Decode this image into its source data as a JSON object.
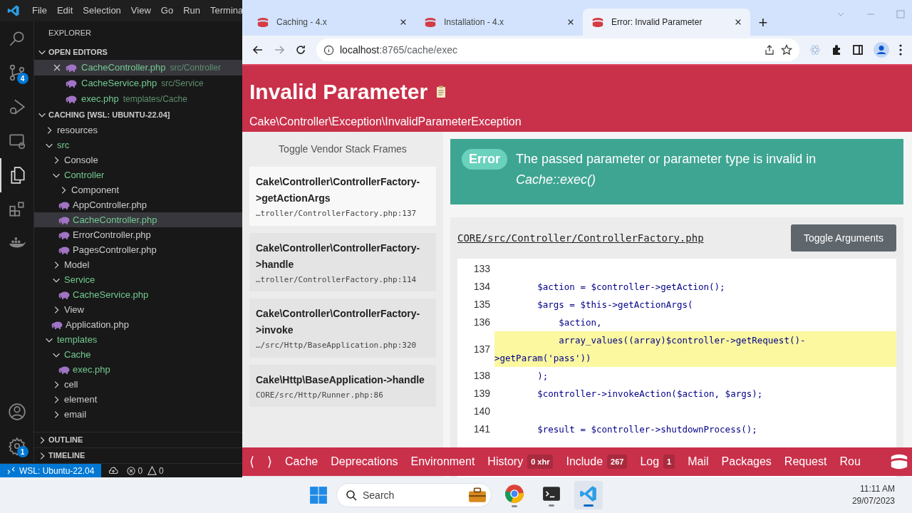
{
  "vscode": {
    "menu": [
      "File",
      "Edit",
      "Selection",
      "View",
      "Go",
      "Run",
      "Termina"
    ],
    "activity": [
      {
        "kind": "search",
        "selected": false
      },
      {
        "kind": "source-control",
        "selected": false,
        "badge": "4"
      },
      {
        "kind": "run-debug",
        "selected": false
      },
      {
        "kind": "remote",
        "selected": false
      },
      {
        "kind": "explorer",
        "selected": true
      },
      {
        "kind": "extensions",
        "selected": false
      },
      {
        "kind": "docker",
        "selected": false
      }
    ],
    "activity_bottom": [
      {
        "kind": "account"
      },
      {
        "kind": "settings",
        "badge": "1"
      }
    ],
    "explorer_title": "EXPLORER",
    "open_editors": {
      "title": "OPEN EDITORS",
      "expanded": true,
      "items": [
        {
          "name": "CacheController.php",
          "path": "src/Controller",
          "selected": true
        },
        {
          "name": "CacheService.php",
          "path": "src/Service",
          "selected": false
        },
        {
          "name": "exec.php",
          "path": "templates/Cache",
          "selected": false
        }
      ]
    },
    "workspace": {
      "title": "CACHING [WSL: UBUNTU-22.04]",
      "expanded": true,
      "tree": [
        {
          "label": "resources",
          "kind": "folder",
          "expanded": false,
          "added": false,
          "selected": false
        },
        {
          "label": "src",
          "kind": "folder",
          "expanded": true,
          "added": true,
          "selected": false,
          "children": [
            {
              "label": "Console",
              "kind": "folder",
              "expanded": false,
              "added": false,
              "selected": false
            },
            {
              "label": "Controller",
              "kind": "folder",
              "expanded": true,
              "added": true,
              "selected": false,
              "children": [
                {
                  "label": "Component",
                  "kind": "folder",
                  "expanded": false,
                  "added": false,
                  "selected": false
                },
                {
                  "label": "AppController.php",
                  "kind": "file",
                  "added": false,
                  "selected": false
                },
                {
                  "label": "CacheController.php",
                  "kind": "file",
                  "added": true,
                  "selected": true
                },
                {
                  "label": "ErrorController.php",
                  "kind": "file",
                  "added": false,
                  "selected": false
                },
                {
                  "label": "PagesController.php",
                  "kind": "file",
                  "added": false,
                  "selected": false
                }
              ]
            },
            {
              "label": "Model",
              "kind": "folder",
              "expanded": false,
              "added": false,
              "selected": false
            },
            {
              "label": "Service",
              "kind": "folder",
              "expanded": true,
              "added": true,
              "selected": false,
              "children": [
                {
                  "label": "CacheService.php",
                  "kind": "file",
                  "added": true,
                  "selected": false
                }
              ]
            },
            {
              "label": "View",
              "kind": "folder",
              "expanded": false,
              "added": false,
              "selected": false
            },
            {
              "label": "Application.php",
              "kind": "file",
              "added": false,
              "selected": false
            }
          ]
        },
        {
          "label": "templates",
          "kind": "folder",
          "expanded": true,
          "added": true,
          "selected": false,
          "children": [
            {
              "label": "Cache",
              "kind": "folder",
              "expanded": true,
              "added": true,
              "selected": false,
              "children": [
                {
                  "label": "exec.php",
                  "kind": "file",
                  "added": true,
                  "selected": false
                }
              ]
            },
            {
              "label": "cell",
              "kind": "folder",
              "expanded": false,
              "added": false,
              "selected": false
            },
            {
              "label": "element",
              "kind": "folder",
              "expanded": false,
              "added": false,
              "selected": false
            },
            {
              "label": "email",
              "kind": "folder",
              "expanded": false,
              "added": false,
              "selected": false
            }
          ]
        }
      ]
    },
    "collapsed_sections": [
      "OUTLINE",
      "TIMELINE"
    ],
    "status_bar": {
      "remote": "WSL: Ubuntu-22.04",
      "errors": "0",
      "warnings": "0"
    }
  },
  "browser": {
    "tabs": [
      {
        "title": "Caching - 4.x",
        "selected": false
      },
      {
        "title": "Installation - 4.x",
        "selected": false
      },
      {
        "title": "Error: Invalid Parameter",
        "selected": true
      }
    ],
    "new_tab": "+",
    "address": {
      "host": "localhost",
      "rest": ":8765/cache/exec"
    },
    "page": {
      "title": "Invalid Parameter",
      "exception": "Cake\\Controller\\Exception\\InvalidParameterException",
      "stack_toggle": "Toggle Vendor Stack Frames",
      "frames": [
        {
          "call": "Cake\\Controller\\ControllerFactory->getActionArgs",
          "file": "…troller/ControllerFactory.php:137",
          "selected": true
        },
        {
          "call": "Cake\\Controller\\ControllerFactory->handle",
          "file": "…troller/ControllerFactory.php:114",
          "selected": false
        },
        {
          "call": "Cake\\Controller\\ControllerFactory->invoke",
          "file": "…/src/Http/BaseApplication.php:320",
          "selected": false
        },
        {
          "call": "Cake\\Http\\BaseApplication->handle",
          "file": "CORE/src/Http/Runner.php:86",
          "selected": false
        }
      ],
      "error": {
        "badge": "Error",
        "message": "The passed parameter or parameter type is invalid in *Cache::exec()*"
      },
      "file_path": "CORE/src/Controller/ControllerFactory.php",
      "toggle_arguments": "Toggle Arguments",
      "code": [
        {
          "number": "133",
          "highlighted": false
        },
        {
          "number": "134",
          "code": "        $action = $controller->getAction();",
          "highlighted": false
        },
        {
          "number": "135",
          "code": "        $args = $this->getActionArgs(",
          "highlighted": false
        },
        {
          "number": "136",
          "code": "            $action,",
          "highlighted": false
        },
        {
          "number": "137",
          "code": "            array_values((array)$controller->getRequest()->getParam('pass'))",
          "highlighted": true
        },
        {
          "number": "138",
          "code": "        );",
          "highlighted": false
        },
        {
          "number": "139",
          "code": "        $controller->invokeAction($action, $args);",
          "highlighted": false
        },
        {
          "number": "140",
          "highlighted": false
        },
        {
          "number": "141",
          "code": "        $result = $controller->shutdownProcess();",
          "highlighted": false
        }
      ],
      "toolbar": {
        "prev": "⟨",
        "next": "⟩",
        "panels": [
          {
            "label": "Cache"
          },
          {
            "label": "Deprecations"
          },
          {
            "label": "Environment"
          },
          {
            "label": "History",
            "count": "0 xhr"
          },
          {
            "label": "Include",
            "count": "267"
          },
          {
            "label": "Log",
            "count": "1"
          },
          {
            "label": "Mail"
          },
          {
            "label": "Packages"
          },
          {
            "label": "Request"
          },
          {
            "label": "Rou"
          }
        ]
      }
    }
  },
  "taskbar": {
    "search": "Search",
    "apps": [
      {
        "kind": "chrome",
        "active": false
      },
      {
        "kind": "terminal",
        "active": false
      },
      {
        "kind": "vscode",
        "active": true
      }
    ],
    "time": "11:11 AM",
    "date": "29/07/2023"
  }
}
